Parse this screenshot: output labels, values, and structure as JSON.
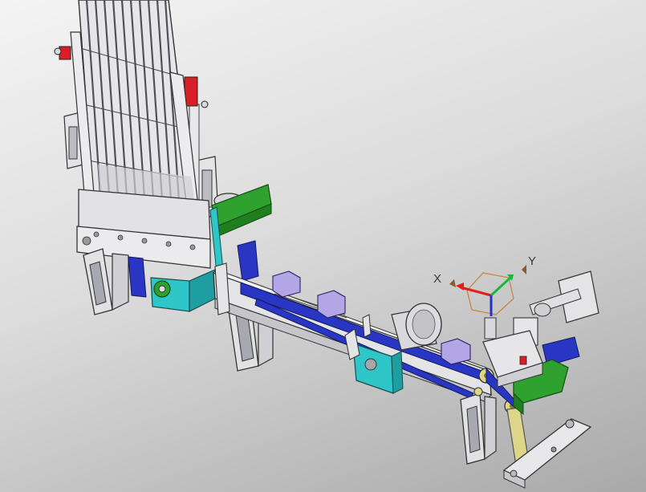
{
  "viewport": {
    "background_top": "#f4f4f4",
    "background_bottom": "#a9a9a9"
  },
  "triad": {
    "x_label": "X",
    "y_label": "Y",
    "x_color": "#e11d1d",
    "y_color": "#17b83a",
    "z_color": "#2430c8",
    "plane_color": "#c8873a"
  },
  "part_colors": {
    "frame_gray": "#e4e4e6",
    "blue": "#2936c4",
    "green": "#2fa12f",
    "cyan": "#2fc6c9",
    "lavender": "#b3a6e6",
    "red": "#d81f26",
    "yellow": "#ddd58a"
  }
}
